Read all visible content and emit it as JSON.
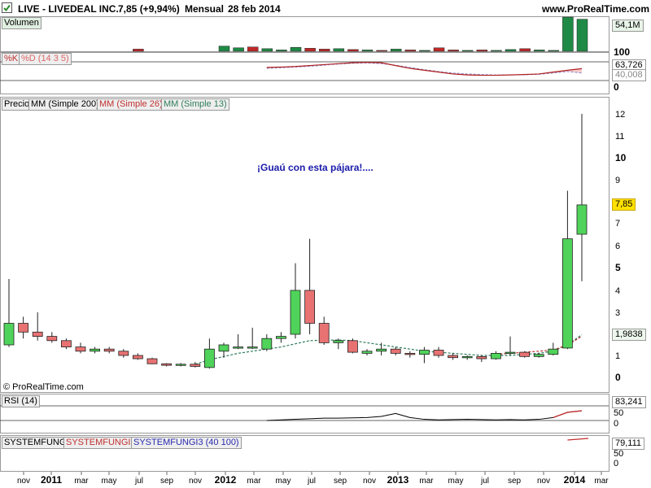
{
  "header": {
    "ticker": "LIVE - LIVEDEAL INC.",
    "price_change": "7,85 (+9,94%)",
    "period": "Mensual",
    "date": "28 feb 2014",
    "site": "www.ProRealTime.com"
  },
  "panels": {
    "volume": {
      "label": "Volumen",
      "value_tag": "54,1M",
      "tick_100": "100"
    },
    "stoch": {
      "label_k": "%K",
      "label_d": "%D (14 3 5)",
      "tag_k": "63,726",
      "tag_d": "40,008",
      "tick_100": "100",
      "tick_0": "0"
    },
    "price": {
      "label": "Precio",
      "ma200": "MM (Simple 200)",
      "ma26": "MM (Simple 26)",
      "ma13": "MM (Simple 13)",
      "annotation": "¡Guaú con esta pájara!....",
      "copyright": "© ProRealTime.com",
      "last_tag": "7,85",
      "ma_tag": "1,9838"
    },
    "rsi": {
      "label": "RSI (14)",
      "tag": "83,241",
      "tick_100": "100",
      "tick_50": "50",
      "tick_0": "0"
    },
    "sys": {
      "label1": "SYSTEMFUNGI",
      "label2": "SYSTEMFUNGI2",
      "label3": "SYSTEMFUNGI3 (40 100)",
      "tag": "79,111",
      "tick_50": "50",
      "tick_0": "0"
    }
  },
  "colors": {
    "up": "#4fd35a",
    "down": "#e87272",
    "ma26": "#c03030",
    "ma13": "#2e7d5a",
    "text_blue": "#1a1aaa"
  },
  "chart_data": {
    "type": "candlestick",
    "title": "LIVE - LIVEDEAL INC.",
    "period": "monthly",
    "y_ticks": [
      0,
      1,
      2,
      3,
      4,
      5,
      6,
      7,
      8,
      9,
      10,
      11,
      12
    ],
    "x_ticks": [
      "nov",
      "2011",
      "mar",
      "may",
      "jul",
      "sep",
      "nov",
      "2012",
      "mar",
      "may",
      "jul",
      "sep",
      "nov",
      "2013",
      "mar",
      "may",
      "jul",
      "sep",
      "nov",
      "2014",
      "mar"
    ],
    "candles": [
      {
        "o": 1.5,
        "h": 4.5,
        "l": 1.4,
        "c": 2.5
      },
      {
        "o": 2.5,
        "h": 2.8,
        "l": 1.8,
        "c": 2.1
      },
      {
        "o": 2.1,
        "h": 3.0,
        "l": 1.7,
        "c": 1.9
      },
      {
        "o": 1.9,
        "h": 2.1,
        "l": 1.6,
        "c": 1.7
      },
      {
        "o": 1.7,
        "h": 1.8,
        "l": 1.3,
        "c": 1.4
      },
      {
        "o": 1.4,
        "h": 1.6,
        "l": 1.1,
        "c": 1.2
      },
      {
        "o": 1.2,
        "h": 1.4,
        "l": 1.1,
        "c": 1.3
      },
      {
        "o": 1.3,
        "h": 1.4,
        "l": 1.1,
        "c": 1.2
      },
      {
        "o": 1.2,
        "h": 1.3,
        "l": 0.9,
        "c": 1.0
      },
      {
        "o": 1.0,
        "h": 1.1,
        "l": 0.8,
        "c": 0.85
      },
      {
        "o": 0.85,
        "h": 0.9,
        "l": 0.6,
        "c": 0.62
      },
      {
        "o": 0.62,
        "h": 0.65,
        "l": 0.5,
        "c": 0.55
      },
      {
        "o": 0.55,
        "h": 0.65,
        "l": 0.5,
        "c": 0.6
      },
      {
        "o": 0.6,
        "h": 0.7,
        "l": 0.45,
        "c": 0.5
      },
      {
        "o": 0.45,
        "h": 1.8,
        "l": 0.4,
        "c": 1.3
      },
      {
        "o": 1.2,
        "h": 1.6,
        "l": 0.9,
        "c": 1.5
      },
      {
        "o": 1.4,
        "h": 2.0,
        "l": 1.3,
        "c": 1.4
      },
      {
        "o": 1.4,
        "h": 2.3,
        "l": 1.3,
        "c": 1.4
      },
      {
        "o": 1.3,
        "h": 2.0,
        "l": 1.2,
        "c": 1.8
      },
      {
        "o": 1.8,
        "h": 2.1,
        "l": 1.6,
        "c": 1.9
      },
      {
        "o": 2.0,
        "h": 5.2,
        "l": 1.8,
        "c": 4.0
      },
      {
        "o": 4.0,
        "h": 6.3,
        "l": 2.0,
        "c": 2.5
      },
      {
        "o": 2.5,
        "h": 2.8,
        "l": 1.5,
        "c": 1.6
      },
      {
        "o": 1.6,
        "h": 1.8,
        "l": 1.3,
        "c": 1.7
      },
      {
        "o": 1.7,
        "h": 1.8,
        "l": 1.1,
        "c": 1.15
      },
      {
        "o": 1.1,
        "h": 1.3,
        "l": 1.0,
        "c": 1.2
      },
      {
        "o": 1.2,
        "h": 1.6,
        "l": 1.0,
        "c": 1.3
      },
      {
        "o": 1.3,
        "h": 1.4,
        "l": 1.0,
        "c": 1.1
      },
      {
        "o": 1.1,
        "h": 1.2,
        "l": 0.9,
        "c": 1.05
      },
      {
        "o": 1.05,
        "h": 1.4,
        "l": 0.65,
        "c": 1.25
      },
      {
        "o": 1.25,
        "h": 1.4,
        "l": 0.9,
        "c": 1.0
      },
      {
        "o": 1.0,
        "h": 1.1,
        "l": 0.8,
        "c": 0.9
      },
      {
        "o": 0.9,
        "h": 1.0,
        "l": 0.8,
        "c": 0.95
      },
      {
        "o": 0.95,
        "h": 1.0,
        "l": 0.7,
        "c": 0.85
      },
      {
        "o": 0.85,
        "h": 1.2,
        "l": 0.8,
        "c": 1.1
      },
      {
        "o": 1.1,
        "h": 1.9,
        "l": 1.0,
        "c": 1.15
      },
      {
        "o": 1.15,
        "h": 1.2,
        "l": 0.9,
        "c": 0.95
      },
      {
        "o": 0.95,
        "h": 1.1,
        "l": 0.9,
        "c": 1.05
      },
      {
        "o": 1.05,
        "h": 1.6,
        "l": 1.0,
        "c": 1.3
      },
      {
        "o": 1.35,
        "h": 8.5,
        "l": 1.3,
        "c": 6.3
      },
      {
        "o": 6.5,
        "h": 12.0,
        "l": 4.4,
        "c": 7.85
      }
    ],
    "ma26": [
      null,
      null,
      null,
      null,
      null,
      null,
      null,
      null,
      null,
      null,
      null,
      null,
      null,
      null,
      null,
      null,
      null,
      null,
      null,
      null,
      null,
      null,
      null,
      null,
      null,
      null,
      null,
      null,
      null,
      null,
      null,
      null,
      null,
      null,
      1.05,
      1.1,
      1.15,
      1.2,
      1.25,
      1.5,
      1.9
    ],
    "ma13": [
      null,
      null,
      null,
      null,
      null,
      null,
      null,
      null,
      null,
      null,
      null,
      null,
      null,
      0.6,
      0.8,
      0.95,
      1.1,
      1.2,
      1.3,
      1.4,
      1.55,
      1.7,
      1.72,
      1.73,
      1.7,
      1.6,
      1.5,
      1.4,
      1.3,
      1.2,
      1.15,
      1.1,
      1.05,
      1.0,
      1.0,
      1.0,
      1.05,
      1.1,
      1.2,
      1.5,
      1.98
    ],
    "volume_values": [
      0,
      0,
      0,
      0,
      0,
      0,
      0,
      0,
      0,
      5,
      0,
      0,
      0,
      0,
      0,
      12,
      8,
      10,
      6,
      3,
      9,
      7,
      5,
      6,
      4,
      3,
      2,
      5,
      3,
      2,
      8,
      3,
      2,
      3,
      2,
      4,
      6,
      3,
      2,
      80,
      75
    ],
    "volume_colors": [
      "u",
      "d",
      "u",
      "d",
      "d",
      "d",
      "u",
      "d",
      "d",
      "d",
      "d",
      "d",
      "u",
      "d",
      "u",
      "u",
      "u",
      "d",
      "u",
      "u",
      "u",
      "d",
      "d",
      "u",
      "d",
      "u",
      "d",
      "u",
      "d",
      "u",
      "d",
      "d",
      "u",
      "d",
      "u",
      "u",
      "d",
      "u",
      "u",
      "u",
      "u"
    ],
    "stoch_k": [
      70,
      72,
      75,
      80,
      85,
      90,
      95,
      97,
      95,
      80,
      65,
      55,
      45,
      35,
      30,
      28,
      28,
      30,
      32,
      35,
      45,
      55,
      63.7
    ],
    "stoch_d": [
      65,
      68,
      72,
      76,
      82,
      88,
      92,
      94,
      90,
      82,
      70,
      58,
      48,
      40,
      35,
      32,
      30,
      30,
      31,
      33,
      40,
      48,
      40.0
    ],
    "rsi": [
      50,
      52,
      54,
      56,
      58,
      58,
      59,
      60,
      64,
      74,
      60,
      54,
      52,
      53,
      54,
      53,
      52,
      53,
      52,
      54,
      60,
      78,
      83.2
    ],
    "sys": [
      79.1
    ]
  }
}
